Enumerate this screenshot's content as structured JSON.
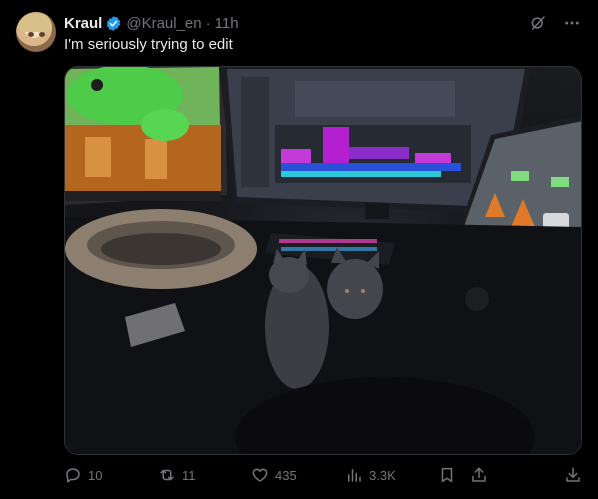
{
  "post": {
    "author": {
      "name": "Kraul",
      "handle": "@Kraul_en",
      "separator": "·",
      "time": "11h"
    },
    "text": "I'm seriously trying to edit",
    "metrics": {
      "replies": "10",
      "reposts": "11",
      "likes": "435",
      "views": "3.3K"
    }
  },
  "icons": {
    "verified": "verified-badge-icon",
    "grok": "grok-icon",
    "more": "more-icon",
    "reply": "reply-icon",
    "repost": "repost-icon",
    "like": "like-icon",
    "views": "views-icon",
    "bookmark": "bookmark-icon",
    "share": "share-icon",
    "download": "download-icon"
  },
  "colors": {
    "background": "#000000",
    "text_primary": "#e7e9ea",
    "text_secondary": "#71767b",
    "verified_blue": "#1d9bf0",
    "border": "#2f3336"
  }
}
